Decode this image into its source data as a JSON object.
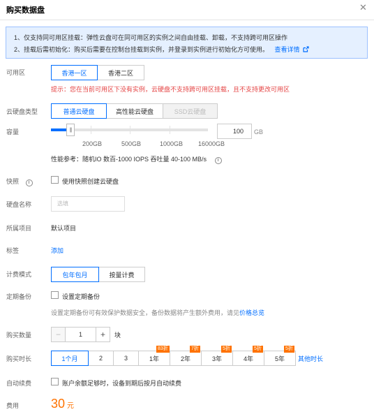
{
  "dialog": {
    "title": "购买数据盘",
    "close_icon": "close-icon"
  },
  "notice": {
    "line1": "1、仅支持同可用区挂载：弹性云盘可在同可用区的实例之间自由挂载、卸载，不支持跨可用区操作",
    "line2": "2、挂载后需初始化：购买后需要在控制台挂载到实例，并登录到实例进行初始化方可使用。",
    "link": "查看详情",
    "link_icon": "external-link-icon"
  },
  "zone": {
    "label": "可用区",
    "options": [
      "香港一区",
      "香港二区"
    ],
    "selected": "香港一区",
    "hint": "提示：您在当前可用区下没有实例，云硬盘不支持跨可用区挂载，且不支持更改可用区"
  },
  "disk_type": {
    "label": "云硬盘类型",
    "options": [
      "普通云硬盘",
      "高性能云硬盘",
      "SSD云硬盘"
    ],
    "selected": "普通云硬盘",
    "disabled": "SSD云硬盘"
  },
  "capacity": {
    "label": "容量",
    "value": "100",
    "unit": "GB",
    "ticks": [
      "200GB",
      "500GB",
      "1000GB",
      "16000GB"
    ],
    "perf": "性能参考：随机IO 数百-1000 IOPS 吞吐量 40-100 MB/s",
    "info_icon": "info-icon"
  },
  "snapshot": {
    "label": "快照",
    "checkbox_label": "使用快照创建云硬盘",
    "checked": false
  },
  "disk_name": {
    "label": "硬盘名称",
    "placeholder": "选填"
  },
  "project": {
    "label": "所属项目",
    "value": "默认项目"
  },
  "tags": {
    "label": "标签",
    "add_link": "添加"
  },
  "billing": {
    "label": "计费模式",
    "options": [
      "包年包月",
      "按量计费"
    ],
    "selected": "包年包月"
  },
  "backup": {
    "label": "定期备份",
    "checkbox_label": "设置定期备份",
    "checked": false,
    "desc": "设置定期备份可有效保护数据安全，备份数据将产生额外费用，请见",
    "desc_link": "价格总览"
  },
  "quantity": {
    "label": "购买数量",
    "value": "1",
    "unit": "块"
  },
  "duration": {
    "label": "购买时长",
    "options": [
      {
        "label": "1个月",
        "badge": ""
      },
      {
        "label": "2",
        "badge": ""
      },
      {
        "label": "3",
        "badge": ""
      },
      {
        "label": "1年",
        "badge": "83折"
      },
      {
        "label": "2年",
        "badge": "7折"
      },
      {
        "label": "3年",
        "badge": "5折"
      },
      {
        "label": "4年",
        "badge": "5折"
      },
      {
        "label": "5年",
        "badge": "5折"
      }
    ],
    "selected": "1个月",
    "more_link": "其他时长"
  },
  "auto_renew": {
    "label": "自动续费",
    "checkbox_label": "账户余额足够时，设备到期后按月自动续费",
    "checked": false
  },
  "fee": {
    "label": "费用",
    "amount": "30",
    "unit": "元"
  },
  "colors": {
    "accent": "#006eff",
    "price": "#ff7200",
    "error": "#e54545",
    "notice_bg": "#e5f0ff"
  }
}
